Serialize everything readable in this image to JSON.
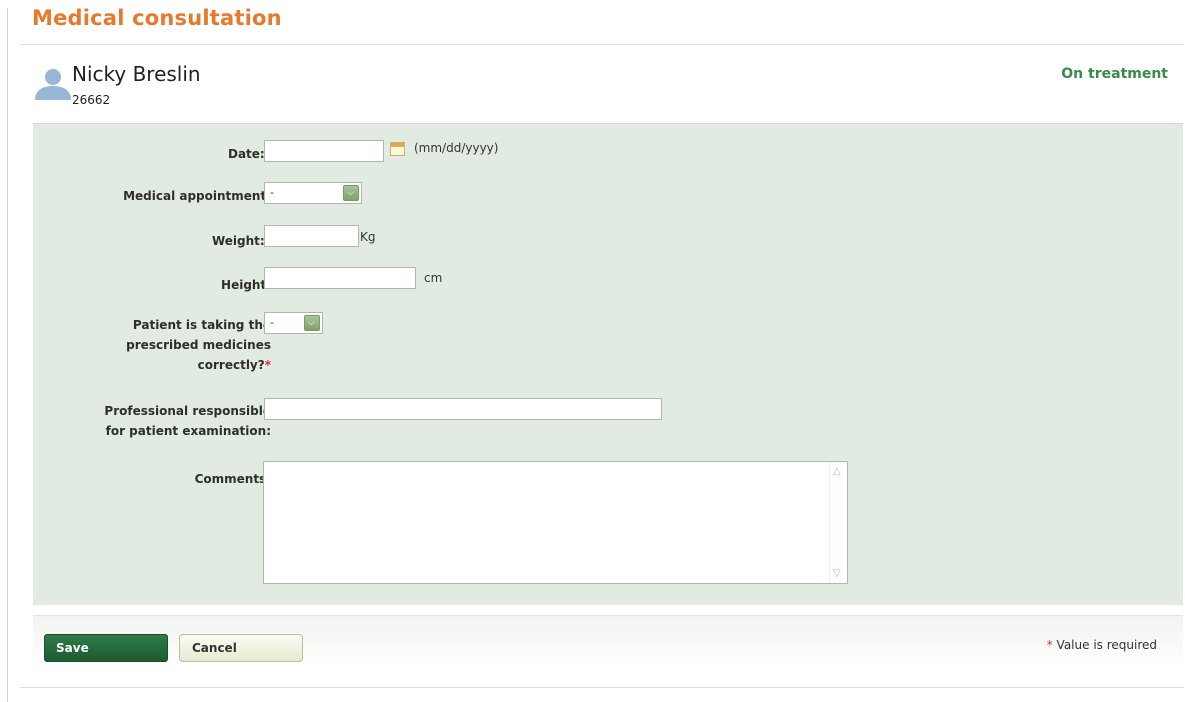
{
  "page": {
    "title": "Medical consultation"
  },
  "patient": {
    "name": "Nicky Breslin",
    "id": "26662",
    "status": "On treatment"
  },
  "form": {
    "required_marker": "*",
    "date": {
      "label": "Date:",
      "value": "",
      "hint": "(mm/dd/yyyy)"
    },
    "appointment": {
      "label": "Medical appointment:",
      "selected": "-"
    },
    "weight": {
      "label": "Weight:",
      "value": "",
      "unit": "Kg"
    },
    "height": {
      "label": "Height:",
      "value": "",
      "unit": "cm"
    },
    "medicines": {
      "label_lines": [
        "Patient is taking the",
        "prescribed medicines",
        "correctly?"
      ],
      "selected": "-"
    },
    "professional": {
      "label_lines": [
        "Professional responsible",
        "for patient examination:"
      ],
      "value": ""
    },
    "comments": {
      "label": "Comments:",
      "value": ""
    }
  },
  "footer": {
    "save_label": "Save",
    "cancel_label": "Cancel",
    "required_note": "Value is required"
  },
  "colors": {
    "title": "#e8782b",
    "status": "#3a8a4c",
    "panel": "#e2ebe1",
    "required": "#d32f2f",
    "save": "#1d5a30"
  },
  "icons": [
    "user-avatar-icon",
    "calendar-icon",
    "dropdown-arrow-icon",
    "scroll-up-icon",
    "scroll-down-icon"
  ]
}
